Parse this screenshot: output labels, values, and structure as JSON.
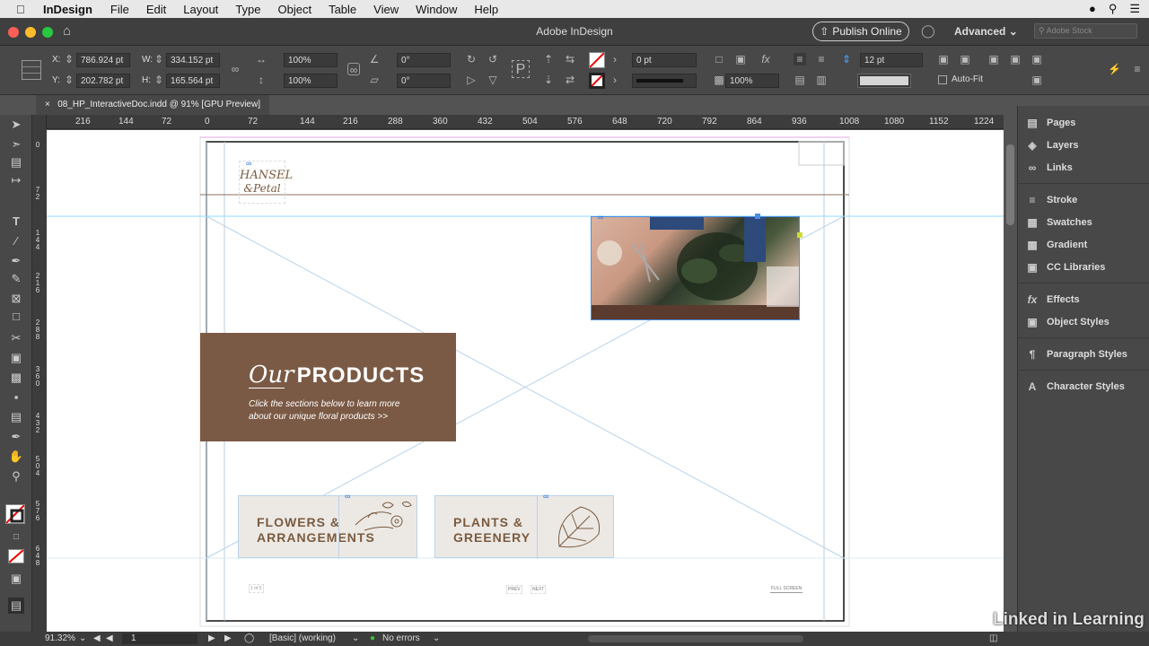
{
  "menubar": {
    "app_name": "InDesign",
    "items": [
      "File",
      "Edit",
      "Layout",
      "Type",
      "Object",
      "Table",
      "View",
      "Window",
      "Help"
    ]
  },
  "titlebar": {
    "title": "Adobe InDesign",
    "publish_label": "Publish Online",
    "workspace_label": "Advanced",
    "stock_placeholder": "Adobe Stock"
  },
  "control": {
    "x_label": "X:",
    "x_value": "786.924 pt",
    "y_label": "Y:",
    "y_value": "202.782 pt",
    "w_label": "W:",
    "w_value": "334.152 pt",
    "h_label": "H:",
    "h_value": "165.564 pt",
    "scale_x": "100%",
    "scale_y": "100%",
    "rotate": "0°",
    "shear": "0°",
    "stroke_weight": "0 pt",
    "opacity": "100%",
    "gutter": "12 pt",
    "autofit_label": "Auto-Fit"
  },
  "tab": {
    "close": "×",
    "label": "08_HP_InteractiveDoc.indd @ 91% [GPU Preview]"
  },
  "ruler": {
    "h_ticks": [
      "216",
      "144",
      "72",
      "0",
      "72",
      "144",
      "216",
      "288",
      "360",
      "432",
      "504",
      "576",
      "648",
      "720",
      "792",
      "864",
      "936",
      "1008",
      "1080",
      "1152",
      "1224"
    ],
    "v_ticks": [
      "0",
      "7\n2",
      "1\n4\n4",
      "2\n1\n6",
      "2\n8\n8",
      "3\n6\n0",
      "4\n3\n2",
      "5\n0\n4",
      "5\n7\n6",
      "6\n4\n8"
    ]
  },
  "document": {
    "logo_line1": "HANSEL",
    "logo_line2": "&Petal",
    "products_script": "Our",
    "products_title": "PRODUCTS",
    "products_desc_line1": "Click the sections below to learn more",
    "products_desc_line2": "about our unique floral products >>",
    "card1_line1": "FLOWERS &",
    "card1_line2": "ARRANGEMENTS",
    "card2_line1": "PLANTS &",
    "card2_line2": "GREENERY",
    "page_num": "1 of 5",
    "prev": "PREV",
    "next": "NEXT",
    "full_screen": "FULL SCREEN"
  },
  "panels": {
    "items": [
      "Pages",
      "Layers",
      "Links",
      "Stroke",
      "Swatches",
      "Gradient",
      "CC Libraries",
      "Effects",
      "Object Styles",
      "Paragraph Styles",
      "Character Styles"
    ]
  },
  "status": {
    "zoom": "91.32%",
    "page": "1",
    "style": "[Basic] (working)",
    "errors": "No errors"
  },
  "watermark": "Linked in Learning",
  "colors": {
    "brown": "#7b5a45",
    "card_bg": "#ece9e5",
    "card_text": "#7a5a3e",
    "guide": "#8fd9ff"
  }
}
